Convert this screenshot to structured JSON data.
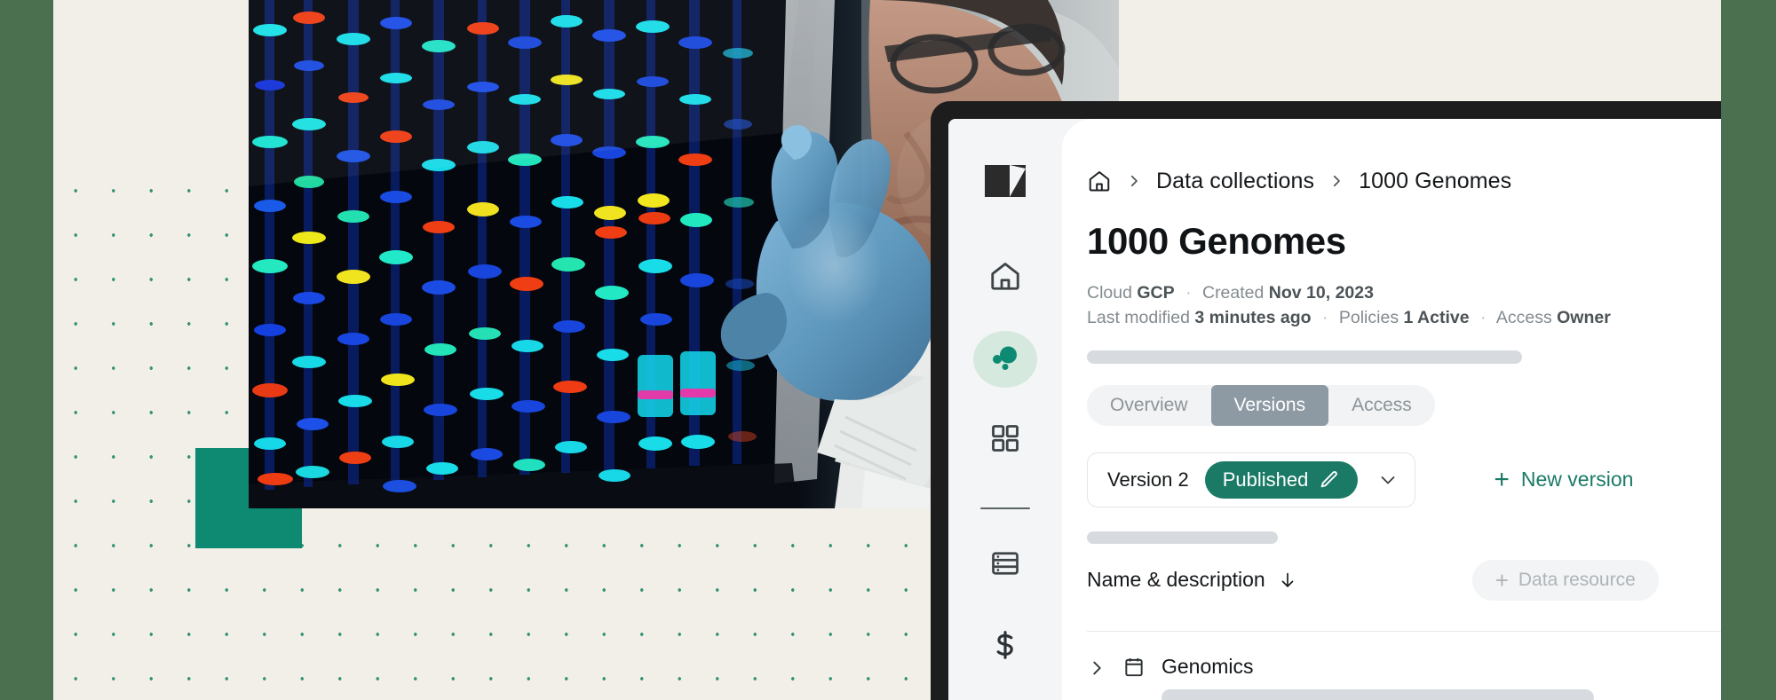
{
  "theme": {
    "brand_green": "#4a7050",
    "teal": "#0e8a72",
    "accent_teal": "#1a7a66",
    "cream": "#f2efe9",
    "tab_selected_bg": "#8d99a3",
    "skeleton": "#d7dbdf"
  },
  "sidebar": {
    "logo_name": "app-logo",
    "items": [
      {
        "icon": "home-icon",
        "name": "sidebar-item-home",
        "active": false
      },
      {
        "icon": "data-collections-bubbles-icon",
        "name": "sidebar-item-data-collections",
        "active": true
      },
      {
        "icon": "apps-grid-icon",
        "name": "sidebar-item-apps",
        "active": false
      },
      {
        "icon": "database-icon",
        "name": "sidebar-item-database",
        "active": false
      },
      {
        "icon": "dollar-icon",
        "name": "sidebar-item-billing",
        "active": false
      }
    ]
  },
  "breadcrumb": {
    "home_icon": "home-icon",
    "items": [
      {
        "label": "Data collections"
      },
      {
        "label": "1000 Genomes"
      }
    ]
  },
  "page": {
    "title": "1000 Genomes"
  },
  "meta": {
    "cloud_label": "Cloud",
    "cloud_value": "GCP",
    "created_label": "Created",
    "created_value": "Nov 10, 2023",
    "modified_label": "Last modified",
    "modified_value": "3 minutes ago",
    "policies_label": "Policies",
    "policies_value": "1 Active",
    "access_label": "Access",
    "access_value": "Owner",
    "separator": "·"
  },
  "tabs": [
    {
      "label": "Overview",
      "selected": false
    },
    {
      "label": "Versions",
      "selected": true
    },
    {
      "label": "Access",
      "selected": false
    }
  ],
  "version": {
    "label": "Version 2",
    "status": "Published",
    "status_icon": "pencil-icon",
    "dropdown_icon": "chevron-down-icon",
    "new_version_label": "New version",
    "new_version_plus": "+"
  },
  "section": {
    "name_description_label": "Name & description",
    "sort_icon": "arrow-down-icon",
    "data_resource_label": "Data resource",
    "data_resource_plus": "+"
  },
  "resources": [
    {
      "label": "Genomics",
      "icon": "table-icon",
      "expand_icon": "chevron-right-icon"
    }
  ]
}
